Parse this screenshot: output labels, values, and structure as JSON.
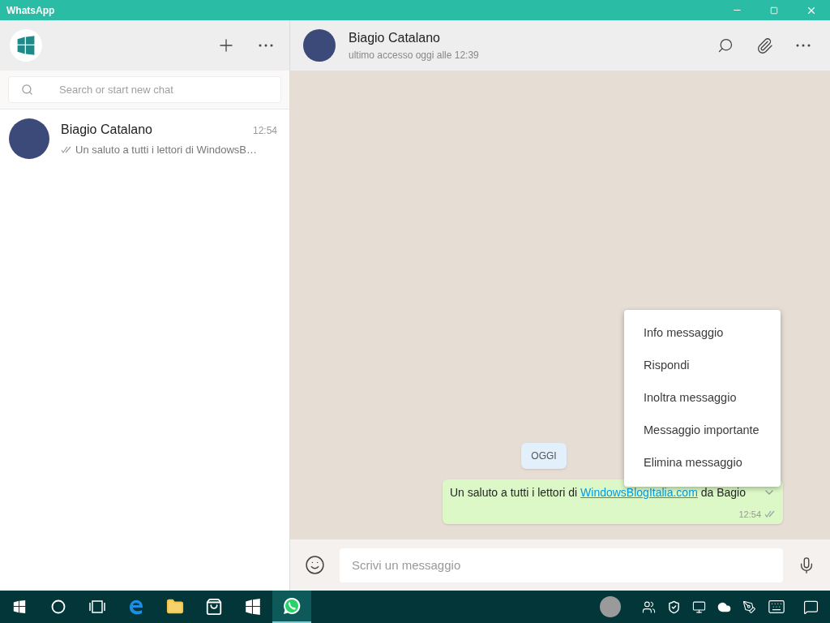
{
  "window": {
    "title": "WhatsApp"
  },
  "search": {
    "placeholder": "Search or start new chat"
  },
  "chats": [
    {
      "name": "Biagio Catalano",
      "time": "12:54",
      "preview": "Un saluto a tutti i lettori di WindowsB…",
      "selected": false
    }
  ],
  "conversation": {
    "name": "Biagio Catalano",
    "status": "ultimo accesso oggi alle 12:39"
  },
  "date_chip": "OGGI",
  "message": {
    "text_before": "Un saluto a tutti i lettori di",
    "link": "WindowsBlogItalia.com",
    "text_after": "da Bagio",
    "time": "12:54"
  },
  "context_menu": [
    "Info messaggio",
    "Rispondi",
    "Inoltra messaggio",
    "Messaggio importante",
    "Elimina messaggio"
  ],
  "composer": {
    "placeholder": "Scrivi un messaggio"
  },
  "taskbar": {
    "apps": [
      {
        "kind": "start",
        "active": false
      },
      {
        "kind": "cortana",
        "active": false
      },
      {
        "kind": "taskview",
        "active": false
      },
      {
        "kind": "edge",
        "active": false
      },
      {
        "kind": "explorer",
        "active": false
      },
      {
        "kind": "store",
        "active": false
      },
      {
        "kind": "windowsblog",
        "active": false
      },
      {
        "kind": "whatsapp",
        "active": true
      }
    ]
  }
}
